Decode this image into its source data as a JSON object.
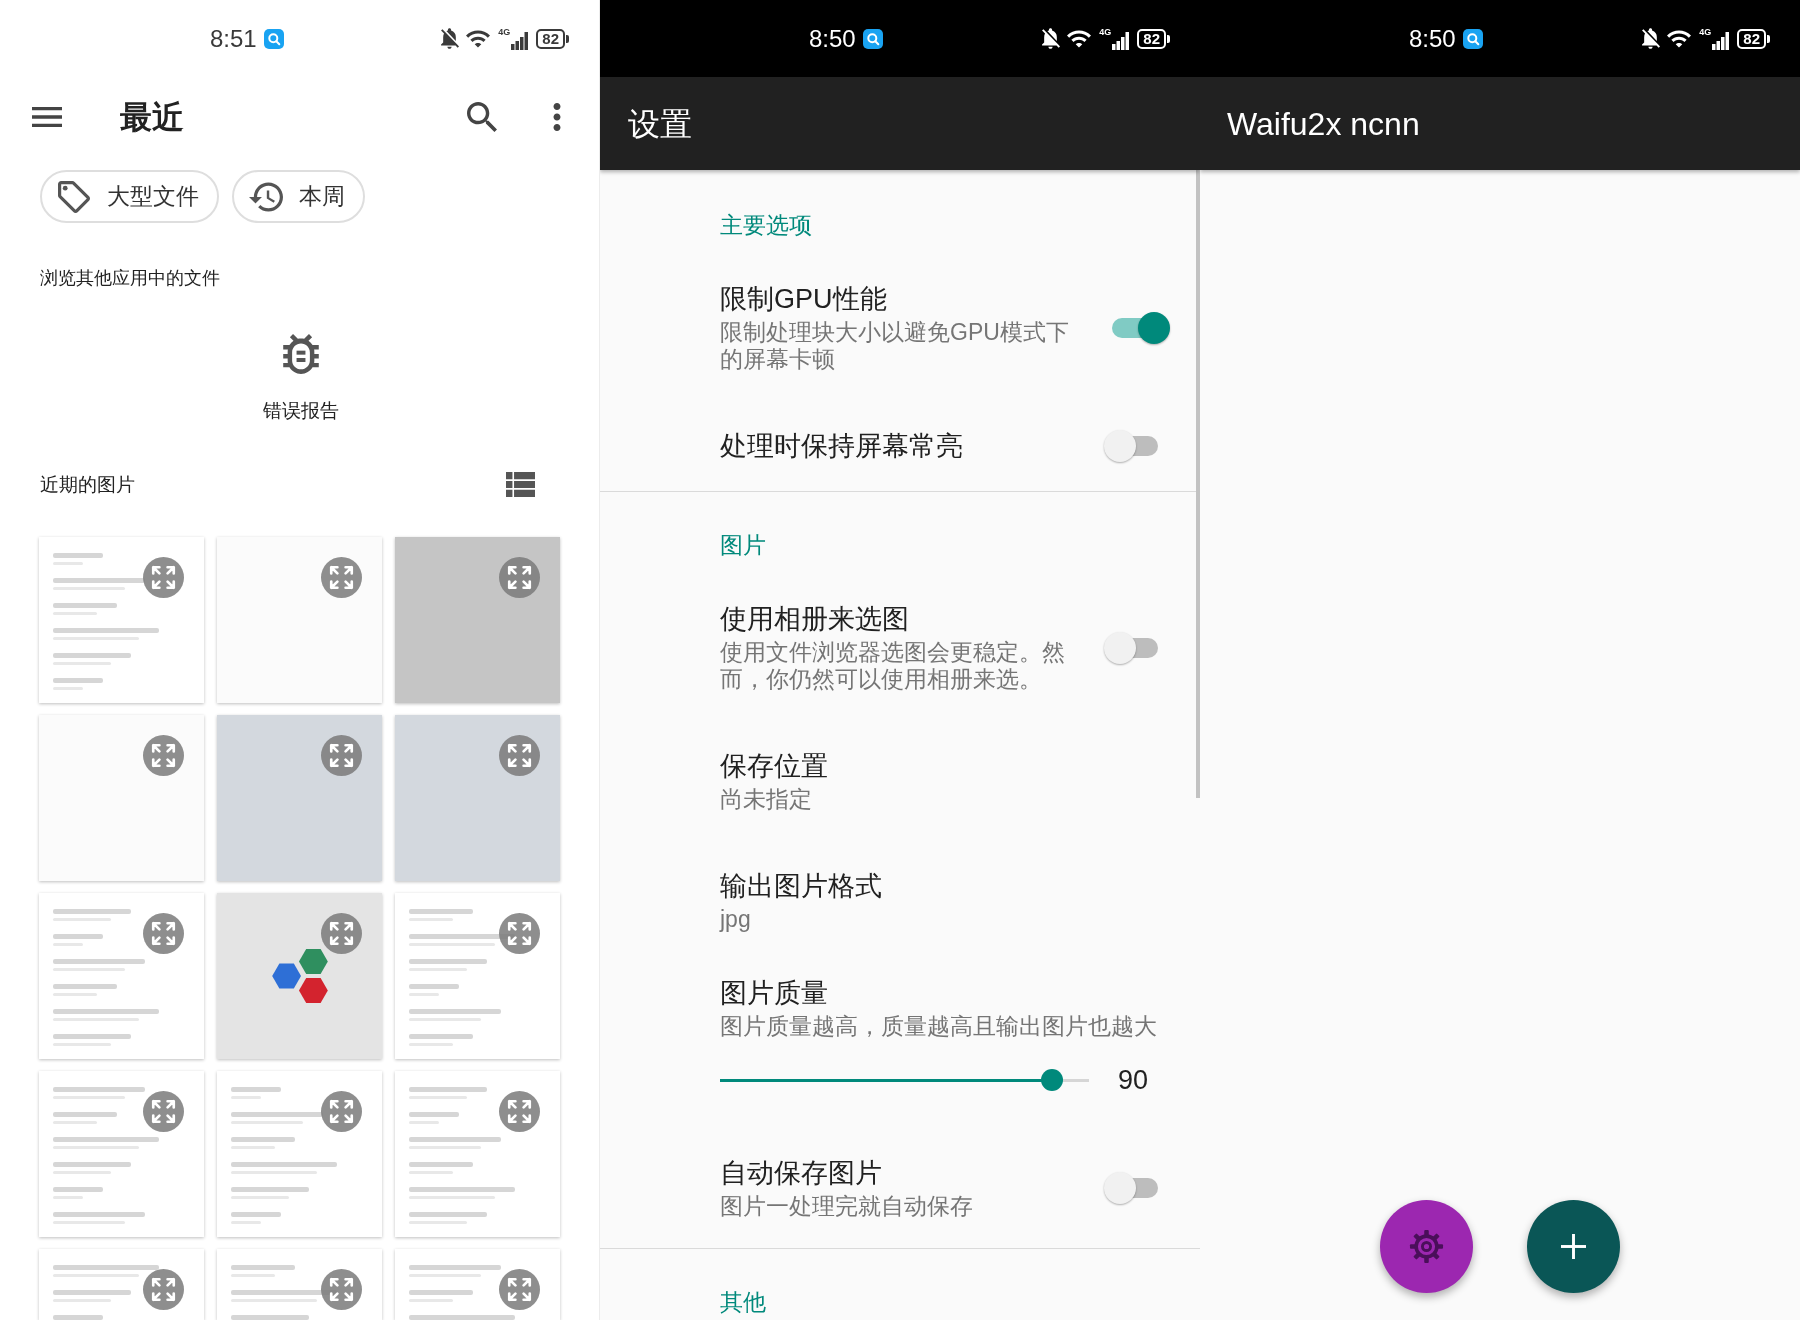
{
  "file_manager": {
    "status_bar": {
      "time": "8:51",
      "network": "4G",
      "battery": "82"
    },
    "toolbar": {
      "title": "最近"
    },
    "chips": [
      {
        "label": "大型文件"
      },
      {
        "label": "本周"
      }
    ],
    "browse_title": "浏览其他应用中的文件",
    "apps": [
      {
        "label": "错误报告"
      }
    ],
    "recent_images": {
      "title": "近期的图片",
      "items": [
        {
          "kind": "screenshot"
        },
        {
          "kind": "blank"
        },
        {
          "kind": "grey"
        },
        {
          "kind": "blank"
        },
        {
          "kind": "photo"
        },
        {
          "kind": "photo"
        },
        {
          "kind": "screenshot"
        },
        {
          "kind": "logo"
        },
        {
          "kind": "screenshot"
        },
        {
          "kind": "screenshot"
        },
        {
          "kind": "screenshot"
        },
        {
          "kind": "screenshot"
        },
        {
          "kind": "screenshot"
        },
        {
          "kind": "screenshot"
        },
        {
          "kind": "screenshot"
        }
      ]
    }
  },
  "settings": {
    "status_bar": {
      "time": "8:50",
      "network": "4G",
      "battery": "82"
    },
    "title": "设置",
    "groups": [
      {
        "title": "主要选项",
        "items": [
          {
            "kind": "switch",
            "title": "限制GPU性能",
            "summary": "限制处理块大小以避免GPU模式下的屏幕卡顿",
            "on": true
          },
          {
            "kind": "switch",
            "title": "处理时保持屏幕常亮",
            "on": false
          }
        ]
      },
      {
        "title": "图片",
        "items": [
          {
            "kind": "switch",
            "title": "使用相册来选图",
            "summary": "使用文件浏览器选图会更稳定。然而，你仍然可以使用相册来选。",
            "on": false
          },
          {
            "kind": "text",
            "title": "保存位置",
            "summary": "尚未指定"
          },
          {
            "kind": "text",
            "title": "输出图片格式",
            "summary": "jpg"
          },
          {
            "kind": "slider",
            "title": "图片质量",
            "summary": "图片质量越高，质量越高且输出图片也越大",
            "level": 0.9,
            "reading": "90"
          },
          {
            "kind": "switch",
            "title": "自动保存图片",
            "summary": "图片一处理完就自动保存",
            "on": false
          }
        ]
      },
      {
        "title": "其他"
      }
    ]
  },
  "waifu2x": {
    "status_bar": {
      "time": "8:50",
      "network": "4G",
      "battery": "82"
    },
    "title": "Waifu2x ncnn"
  }
}
